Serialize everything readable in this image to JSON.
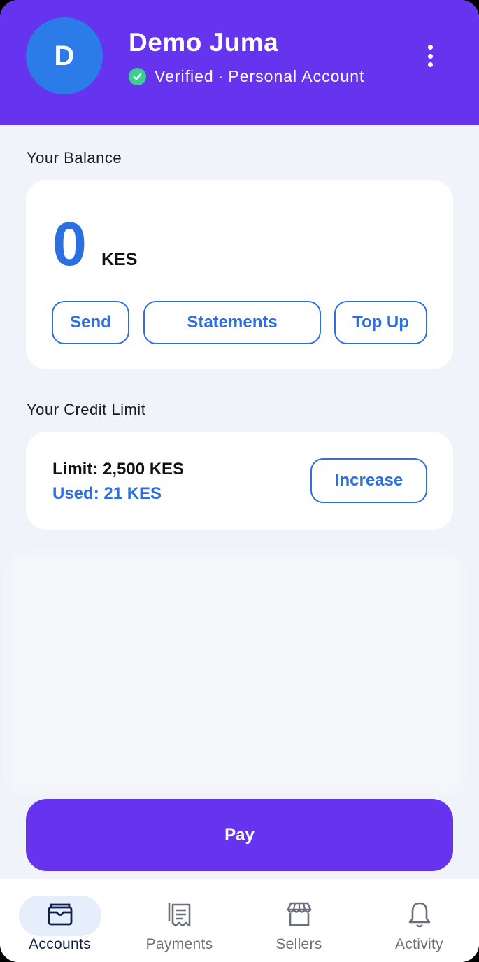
{
  "header": {
    "avatar_initial": "D",
    "user_name": "Demo Juma",
    "status": "Verified",
    "separator": "·",
    "account_type": "Personal Account"
  },
  "balance": {
    "section_label": "Your Balance",
    "amount": "0",
    "currency": "KES",
    "buttons": {
      "send": "Send",
      "statements": "Statements",
      "top_up": "Top Up"
    }
  },
  "credit": {
    "section_label": "Your Credit Limit",
    "limit_text": "Limit: 2,500 KES",
    "used_text": "Used: 21 KES",
    "increase_label": "Increase"
  },
  "pay_label": "Pay",
  "nav": {
    "items": [
      {
        "label": "Accounts",
        "icon": "wallet-icon",
        "active": true
      },
      {
        "label": "Payments",
        "icon": "receipt-icon",
        "active": false
      },
      {
        "label": "Sellers",
        "icon": "store-icon",
        "active": false
      },
      {
        "label": "Activity",
        "icon": "bell-icon",
        "active": false
      }
    ]
  },
  "colors": {
    "primary_purple": "#6633ee",
    "accent_blue": "#2b6fe0",
    "verified_green": "#3ecf8e",
    "background": "#f0f3fa"
  }
}
